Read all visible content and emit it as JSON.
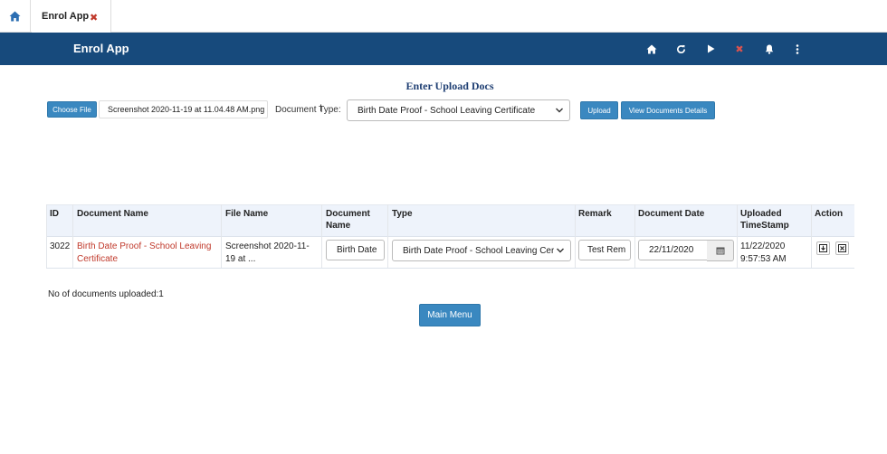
{
  "tabstrip": {
    "home_icon": "home-icon",
    "tab_label": "Enrol App",
    "close_icon": "close-icon"
  },
  "header": {
    "title": "Enrol App",
    "icons": [
      "home-icon",
      "refresh-icon",
      "play-icon",
      "close-icon",
      "bell-icon",
      "more-vertical-icon"
    ],
    "background": "#174a7c"
  },
  "form": {
    "heading": "Enter Upload Docs",
    "choose_file_label": "Choose File",
    "file_name": "Screenshot 2020-11-19 at 11.04.48 AM.png",
    "document_type_label": "Document Type:",
    "document_type_value": "Birth Date Proof - School Leaving Certificate",
    "upload_label": "Upload",
    "view_details_label": "View Documents Details",
    "accent": "#3a88c0"
  },
  "table": {
    "headers": {
      "id": "ID",
      "document_name": "Document Name",
      "file_name": "File Name",
      "document_name_col_1": "Document",
      "document_name_col_2": "Name",
      "type": "Type",
      "remark": "Remark",
      "document_date": "Document Date",
      "uploaded_1": "Uploaded",
      "uploaded_2": "TimeStamp",
      "action": "Action"
    },
    "rows": [
      {
        "id": "3022",
        "document_name_1": "Birth Date Proof - School Leaving",
        "document_name_2": "Certificate",
        "file_name_1": "Screenshot 2020-11-",
        "file_name_2": "19 at ...",
        "doc_name_input": "Birth Date",
        "type_select": "Birth Date Proof - School Leaving Cer",
        "remark_input": "Test Rem",
        "date_input": "22/11/2020",
        "uploaded_1": "11/22/2020",
        "uploaded_2": "9:57:53 AM",
        "link_color": "#c0392b"
      }
    ]
  },
  "footer": {
    "count_text": "No of documents uploaded:1",
    "main_menu_label": "Main Menu"
  }
}
